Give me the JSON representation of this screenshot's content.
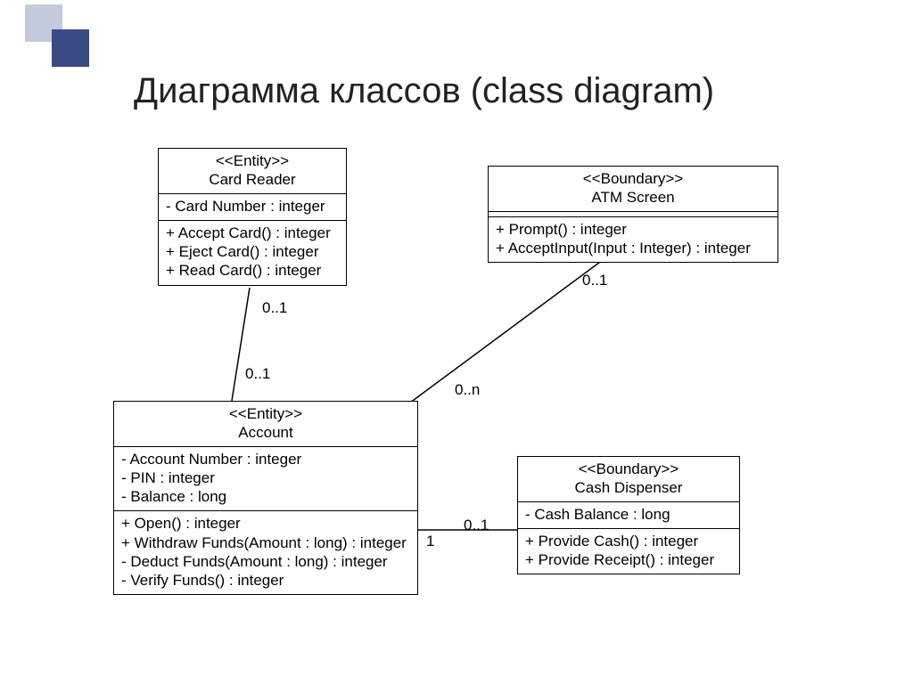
{
  "title": "Диаграмма классов (class diagram)",
  "classes": {
    "cardReader": {
      "stereotype": "<<Entity>>",
      "name": "Card Reader",
      "attributes": [
        "- Card Number : integer"
      ],
      "operations": [
        "+ Accept Card() : integer",
        "+ Eject Card() : integer",
        "+ Read Card() : integer"
      ]
    },
    "atmScreen": {
      "stereotype": "<<Boundary>>",
      "name": "ATM Screen",
      "attributes": [],
      "operations": [
        "+ Prompt() : integer",
        "+ AcceptInput(Input : Integer) : integer"
      ]
    },
    "account": {
      "stereotype": "<<Entity>>",
      "name": "Account",
      "attributes": [
        "- Account Number : integer",
        "- PIN : integer",
        "- Balance : long"
      ],
      "operations": [
        "+ Open() : integer",
        "+ Withdraw Funds(Amount : long) : integer",
        "- Deduct Funds(Amount : long) : integer",
        "- Verify Funds() : integer"
      ]
    },
    "cashDispenser": {
      "stereotype": "<<Boundary>>",
      "name": "Cash Dispenser",
      "attributes": [
        "- Cash Balance : long"
      ],
      "operations": [
        "+ Provide Cash() : integer",
        "+ Provide Receipt() : integer"
      ]
    }
  },
  "associations": {
    "cardReader_account": {
      "endA": "0..1",
      "endB": "0..1"
    },
    "atmScreen_account": {
      "endA": "0..1",
      "endB": "0..n"
    },
    "account_cashDispenser": {
      "endA": "1",
      "endB": "0..1"
    }
  }
}
